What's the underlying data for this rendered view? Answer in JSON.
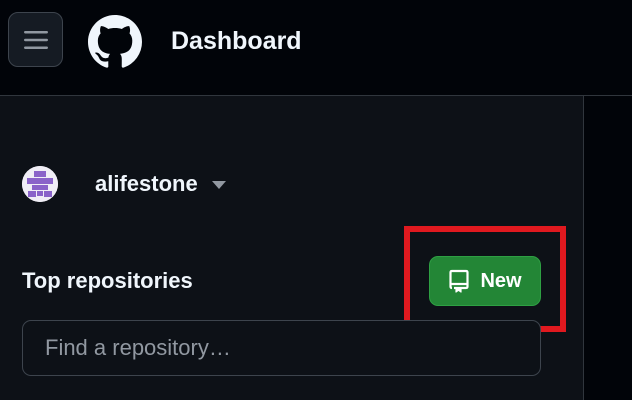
{
  "header": {
    "title": "Dashboard",
    "menu_icon": "hamburger-menu-icon",
    "logo_icon": "github-octocat-icon"
  },
  "sidebar": {
    "context": {
      "username": "alifestone",
      "avatar_icon": "identicon-avatar",
      "caret_icon": "caret-down-icon"
    },
    "top_repositories": {
      "title": "Top repositories",
      "new_button_label": "New",
      "new_button_icon": "repo-icon",
      "search_placeholder": "Find a repository…",
      "search_value": ""
    }
  },
  "colors": {
    "header_bg": "#010409",
    "sidebar_bg": "#0d1117",
    "new_button_bg": "#238636",
    "highlight": "#e0191f",
    "avatar_fg": "#8a63c9"
  }
}
